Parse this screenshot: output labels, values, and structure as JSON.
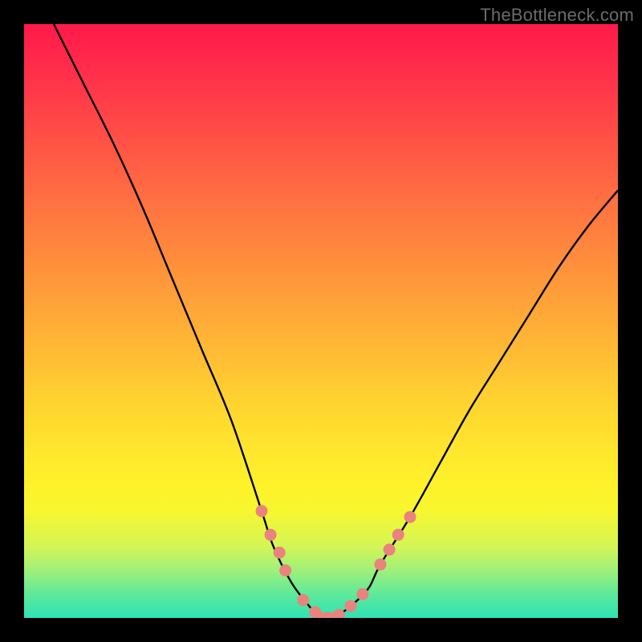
{
  "watermark": "TheBottleneck.com",
  "chart_data": {
    "type": "line",
    "title": "",
    "xlabel": "",
    "ylabel": "",
    "xlim": [
      0,
      100
    ],
    "ylim": [
      0,
      100
    ],
    "series": [
      {
        "name": "bottleneck-curve",
        "x": [
          5,
          10,
          15,
          20,
          25,
          30,
          35,
          40,
          42,
          45,
          48,
          50,
          52,
          55,
          58,
          60,
          65,
          70,
          75,
          80,
          85,
          90,
          95,
          100
        ],
        "y": [
          100,
          90,
          80,
          69,
          57,
          45,
          33,
          18,
          12,
          6,
          2,
          0,
          0,
          2,
          5,
          9,
          17,
          26,
          35,
          43,
          51,
          59,
          66,
          72
        ]
      }
    ],
    "markers": {
      "name": "highlight-dots",
      "x": [
        40,
        41.5,
        43,
        44,
        47,
        49,
        50,
        51,
        52,
        53,
        55,
        57,
        60,
        61.5,
        63,
        65
      ],
      "y": [
        18,
        14,
        11,
        8,
        3,
        1,
        0,
        0,
        0,
        0.5,
        2,
        4,
        9,
        11.5,
        14,
        17
      ]
    },
    "gradient_stops": [
      {
        "pos": 0.0,
        "color": "#ff1a4a"
      },
      {
        "pos": 0.5,
        "color": "#ffb434"
      },
      {
        "pos": 0.8,
        "color": "#fff22a"
      },
      {
        "pos": 1.0,
        "color": "#2ee3b5"
      }
    ]
  }
}
